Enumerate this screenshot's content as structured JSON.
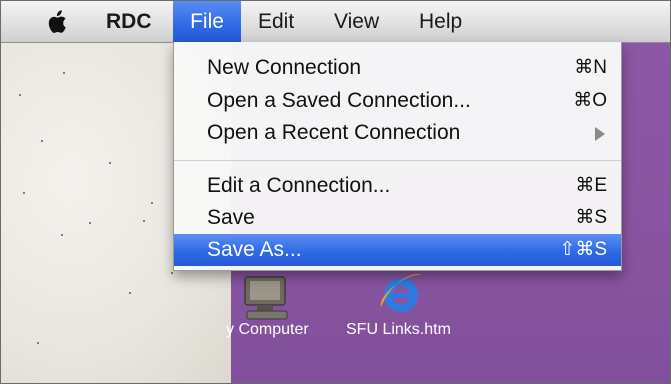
{
  "menubar": {
    "apple_icon": "apple-icon",
    "app_name": "RDC",
    "menus": [
      "File",
      "Edit",
      "View",
      "Help"
    ]
  },
  "file_menu": {
    "items": [
      {
        "label": "New Connection",
        "shortcut": "⌘N"
      },
      {
        "label": "Open a Saved Connection...",
        "shortcut": "⌘O"
      },
      {
        "label": "Open a Recent Connection",
        "submenu_icon": "chevron-right-icon"
      },
      {
        "label": "Edit a Connection...",
        "shortcut": "⌘E"
      },
      {
        "label": "Save",
        "shortcut": "⌘S"
      },
      {
        "label": "Save As...",
        "shortcut": "⇧⌘S",
        "selected": true
      }
    ]
  },
  "desktop": {
    "icons": [
      {
        "label": "y Computer",
        "icon": "my-computer-icon"
      },
      {
        "label": "SFU Links.htm",
        "icon": "internet-explorer-icon"
      }
    ]
  },
  "colors": {
    "highlight": "#2f6ae6",
    "desktop_purple": "#8a55a0"
  }
}
